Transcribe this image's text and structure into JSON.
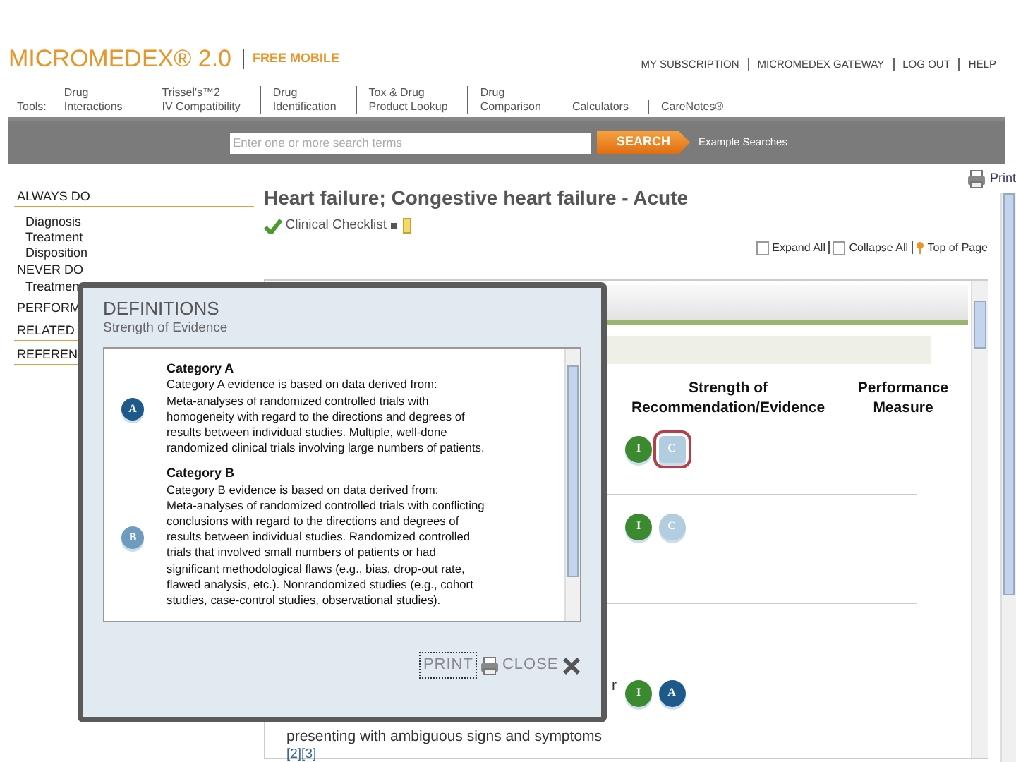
{
  "header": {
    "logo": "MICROMEDEX® 2.0",
    "edition": "FREE MOBILE",
    "links": [
      "MY SUBSCRIPTION",
      "MICROMEDEX GATEWAY",
      "LOG OUT",
      "HELP"
    ]
  },
  "tools": {
    "label": "Tools:",
    "items": [
      {
        "line1": "Drug",
        "line2": "Interactions"
      },
      {
        "line1": "Trissel's™2",
        "line2": "IV Compatibility"
      },
      {
        "line1": "Drug",
        "line2": "Identification"
      },
      {
        "line1": "Tox & Drug",
        "line2": "Product Lookup"
      },
      {
        "line1": "Drug",
        "line2": "Comparison"
      },
      {
        "line2": "Calculators"
      },
      {
        "line2": "CareNotes®"
      }
    ]
  },
  "search": {
    "placeholder": "Enter one or more search terms",
    "button": "SEARCH",
    "link": "Example Searches"
  },
  "sidebar": {
    "items": [
      {
        "label": "ALWAYS DO",
        "children": [
          {
            "label": "Diagnosis"
          },
          {
            "label": "Treatment"
          },
          {
            "label": "Disposition"
          }
        ]
      },
      {
        "label": "NEVER DO",
        "children": [
          {
            "label": "Treatmen"
          }
        ]
      },
      {
        "label": "PERFORM"
      },
      {
        "label": "RELATED"
      },
      {
        "label": "REFEREN"
      }
    ]
  },
  "main": {
    "title": "Heart failure; Congestive heart failure - Acute",
    "print": "Print",
    "checklist": "Clinical Checklist",
    "controls": [
      "Expand All",
      "Collapse All",
      "Top of Page"
    ],
    "columns": [
      "Strength of Recommendation/Evidence",
      "Performance Measure"
    ],
    "rows": [
      {
        "badges": [
          {
            "letter": "I",
            "color": "#3b8a2f",
            "selected": false
          },
          {
            "letter": "C",
            "color": "#b3cde0",
            "selected": true
          }
        ]
      },
      {
        "badges": [
          {
            "letter": "I",
            "color": "#3b8a2f",
            "selected": false
          },
          {
            "letter": "C",
            "color": "#b3cde0",
            "selected": false
          }
        ]
      },
      {
        "lines": [
          "r",
          "presenting with ambiguous signs and symptoms"
        ],
        "refs": "[2][3]",
        "badges": [
          {
            "letter": "I",
            "color": "#3b8a2f",
            "selected": false
          },
          {
            "letter": "A",
            "color": "#1d5a8a",
            "selected": false
          }
        ]
      }
    ]
  },
  "dialog": {
    "title": "DEFINITIONS",
    "subtitle": "Strength of Evidence",
    "entries": [
      {
        "letter": "A",
        "color": "#1d5a8a",
        "heading": "Category A",
        "lines": [
          "Category A evidence is based on data derived from:",
          "Meta-analyses of randomized controlled trials with",
          "homogeneity with regard to the directions and degrees of",
          "results between individual studies. Multiple, well-done",
          "randomized clinical trials involving large numbers of patients."
        ]
      },
      {
        "letter": "B",
        "color": "#6f9cbe",
        "heading": "Category B",
        "lines": [
          "Category B evidence is based on data derived from:",
          "Meta-analyses of randomized controlled trials with conflicting",
          "conclusions with regard to the directions and degrees of",
          "results between individual studies. Randomized controlled",
          "trials that involved small numbers of patients or had",
          "significant methodological flaws (e.g., bias, drop-out rate,",
          "flawed analysis, etc.). Nonrandomized studies (e.g., cohort",
          "studies, case-control studies, observational studies)."
        ]
      }
    ],
    "print": "PRINT",
    "close": "CLOSE"
  }
}
